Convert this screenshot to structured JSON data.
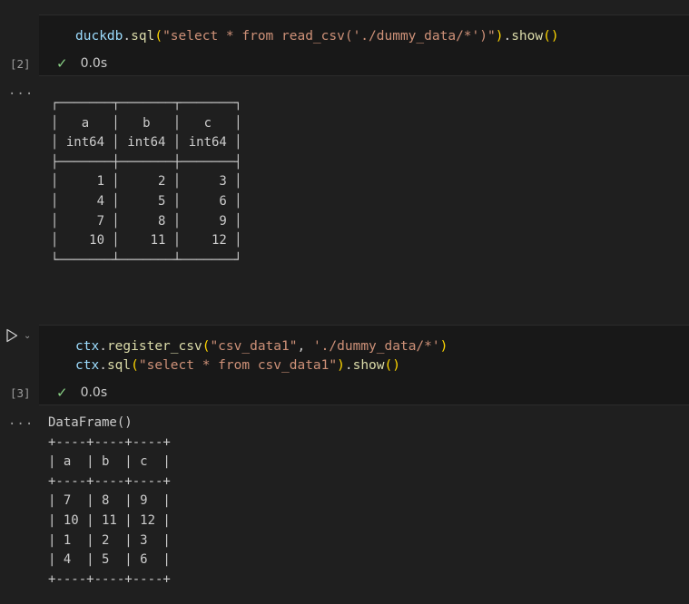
{
  "cells": [
    {
      "execution_count": "[2]",
      "code_lines": [
        [
          {
            "t": "duckdb",
            "c": "var"
          },
          {
            "t": ".",
            "c": "pun"
          },
          {
            "t": "sql",
            "c": "fn"
          },
          {
            "t": "(",
            "c": "par"
          },
          {
            "t": "\"select * from read_csv('./dummy_data/*')\"",
            "c": "str"
          },
          {
            "t": ")",
            "c": "par"
          },
          {
            "t": ".",
            "c": "pun"
          },
          {
            "t": "show",
            "c": "fn"
          },
          {
            "t": "()",
            "c": "par"
          }
        ]
      ],
      "status_time": "0.0s",
      "output_menu": "...",
      "output_lines": [
        "┌───────┬───────┬───────┐",
        "│   a   │   b   │   c   │",
        "│ int64 │ int64 │ int64 │",
        "├───────┼───────┼───────┤",
        "│     1 │     2 │     3 │",
        "│     4 │     5 │     6 │",
        "│     7 │     8 │     9 │",
        "│    10 │    11 │    12 │",
        "└───────┴───────┴───────┘"
      ]
    },
    {
      "execution_count": "[3]",
      "code_lines": [
        [
          {
            "t": "ctx",
            "c": "var"
          },
          {
            "t": ".",
            "c": "pun"
          },
          {
            "t": "register_csv",
            "c": "fn"
          },
          {
            "t": "(",
            "c": "par"
          },
          {
            "t": "\"csv_data1\"",
            "c": "str"
          },
          {
            "t": ", ",
            "c": "pun"
          },
          {
            "t": "'./dummy_data/*'",
            "c": "str"
          },
          {
            "t": ")",
            "c": "par"
          }
        ],
        [
          {
            "t": "ctx",
            "c": "var"
          },
          {
            "t": ".",
            "c": "pun"
          },
          {
            "t": "sql",
            "c": "fn"
          },
          {
            "t": "(",
            "c": "par"
          },
          {
            "t": "\"select * from csv_data1\"",
            "c": "str"
          },
          {
            "t": ")",
            "c": "par"
          },
          {
            "t": ".",
            "c": "pun"
          },
          {
            "t": "show",
            "c": "fn"
          },
          {
            "t": "()",
            "c": "par"
          }
        ]
      ],
      "status_time": "0.0s",
      "output_menu": "...",
      "output_lines": [
        "DataFrame()",
        "+----+----+----+",
        "| a  | b  | c  |",
        "+----+----+----+",
        "| 7  | 8  | 9  |",
        "| 10 | 11 | 12 |",
        "| 1  | 2  | 3  |",
        "| 4  | 5  | 6  |",
        "+----+----+----+"
      ]
    }
  ],
  "icons": {
    "run": "play-icon",
    "run_options": "chevron-down-icon",
    "success": "checkmark-icon"
  },
  "colors": {
    "background": "#1f1f1f",
    "cell_background": "#181818",
    "success": "#89d185",
    "string": "#ce9178",
    "function": "#dcdcaa",
    "variable": "#9cdcfe",
    "bracket": "#ffd700"
  }
}
